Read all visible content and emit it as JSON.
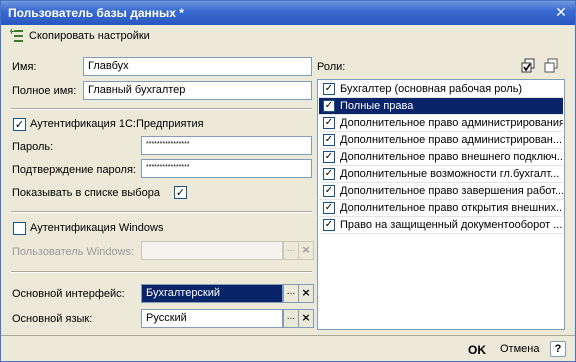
{
  "window": {
    "title": "Пользователь базы данных *"
  },
  "toolbar": {
    "copy_label": "Скопировать настройки"
  },
  "form": {
    "name_label": "Имя:",
    "name_value": "Главбух",
    "fullname_label": "Полное имя:",
    "fullname_value": "Главный бухгалтер",
    "auth1c_label": "Аутентификация 1С:Предприятия",
    "auth1c_checked": true,
    "password_label": "Пароль:",
    "password_value": "****************",
    "confirm_label": "Подтверждение пароля:",
    "confirm_value": "****************",
    "show_in_list_label": "Показывать в списке выбора",
    "show_in_list_checked": true,
    "auth_windows_label": "Аутентификация Windows",
    "auth_windows_checked": false,
    "windows_user_label": "Пользователь Windows:",
    "windows_user_value": "",
    "interface_label": "Основной интерфейс:",
    "interface_value": "Бухгалтерский",
    "language_label": "Основной язык:",
    "language_value": "Русский",
    "select_button": "...",
    "clear_button": "×"
  },
  "roles": {
    "label": "Роли:",
    "items": [
      {
        "label": "Бухгалтер (основная рабочая роль)",
        "checked": true,
        "selected": false
      },
      {
        "label": "Полные права",
        "checked": true,
        "selected": true
      },
      {
        "label": "Дополнительное право администрирования",
        "checked": true,
        "selected": false
      },
      {
        "label": "Дополнительное право администрирован...",
        "checked": true,
        "selected": false
      },
      {
        "label": "Дополнительное право внешнего подключ...",
        "checked": true,
        "selected": false
      },
      {
        "label": "Дополнительные возможности гл.бухгалт...",
        "checked": true,
        "selected": false
      },
      {
        "label": "Дополнительное право завершения работ...",
        "checked": true,
        "selected": false
      },
      {
        "label": "Дополнительное право открытия внешних...",
        "checked": true,
        "selected": false
      },
      {
        "label": "Право на защищенный документооборот ...",
        "checked": true,
        "selected": false
      }
    ]
  },
  "footer": {
    "ok_label": "OK",
    "cancel_label": "Отмена",
    "help_label": "?"
  },
  "icons": [
    "copy-settings-icon",
    "close-icon",
    "check-all-icon",
    "uncheck-all-icon",
    "help-icon"
  ]
}
